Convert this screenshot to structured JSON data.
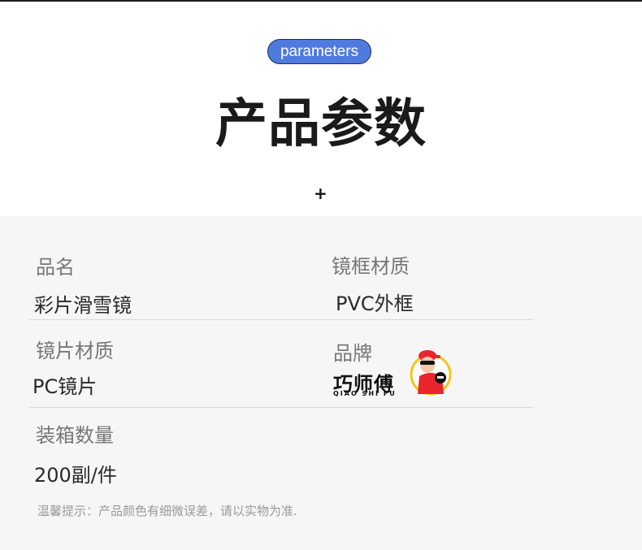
{
  "header": {
    "badge": "parameters",
    "title": "产品参数",
    "plus": "+"
  },
  "params": {
    "name_label": "品名",
    "name_value": "彩片滑雪镜",
    "frame_label": "镜框材质",
    "frame_value": "PVC外框",
    "lens_label": "镜片材质",
    "lens_value": "PC镜片",
    "brand_label": "品牌",
    "brand_logo_text": "巧师傅",
    "brand_logo_sub": "QIAO SHI FU",
    "pack_label": "装箱数量",
    "pack_value": "200副/件"
  },
  "note": "温馨提示：产品颜色有细微误差，请以实物为准.",
  "colors": {
    "badge": "#4f7be0",
    "panel": "#f6f6f6",
    "mascot_red": "#e8262b",
    "mascot_yellow": "#f5c518"
  }
}
